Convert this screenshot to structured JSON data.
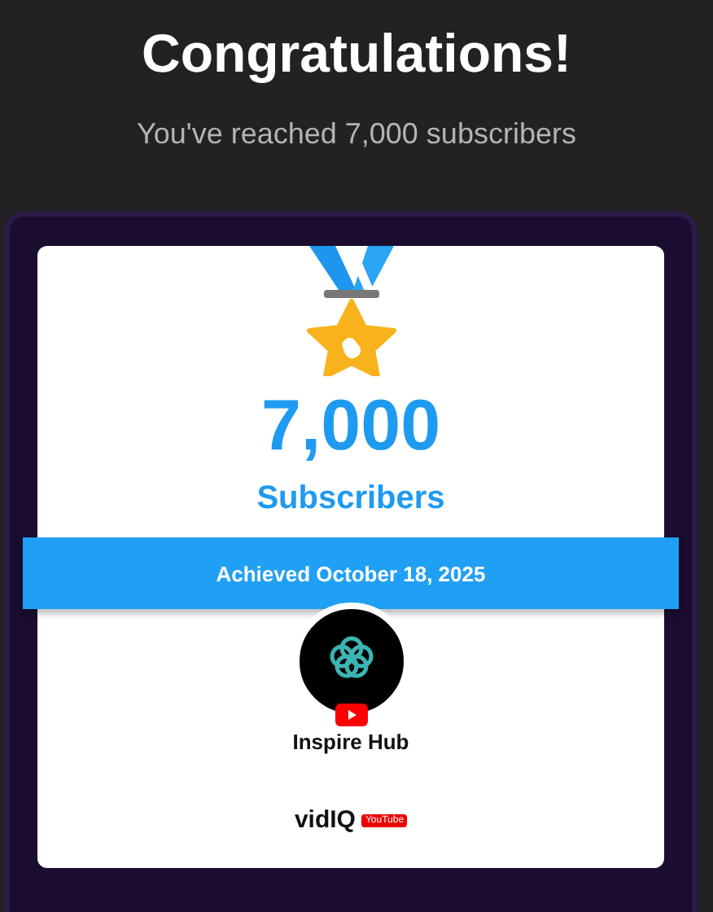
{
  "header": {
    "title": "Congratulations!",
    "subtitle": "You've reached 7,000 subscribers"
  },
  "card": {
    "count": "7,000",
    "unit": "Subscribers",
    "achieved": "Achieved October 18, 2025",
    "channel": {
      "name": "Inspire Hub"
    },
    "footer": {
      "brand": "vidIQ",
      "partner": "YouTube"
    }
  }
}
